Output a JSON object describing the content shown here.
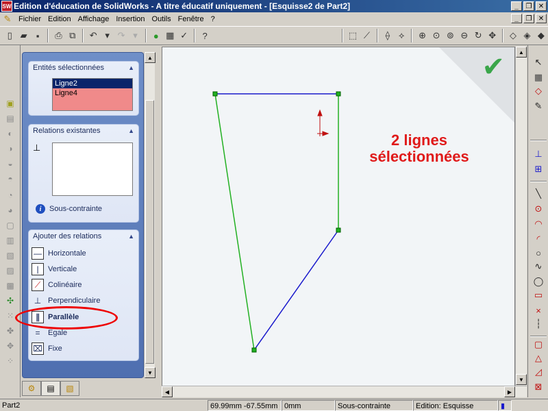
{
  "window": {
    "logo": "SW",
    "title": "Edition d'éducation de SolidWorks - A titre éducatif uniquement - [Esquisse2 de Part2]",
    "minimize": "_",
    "restore": "❐",
    "close": "✕"
  },
  "menu": {
    "items": [
      "Fichier",
      "Edition",
      "Affichage",
      "Insertion",
      "Outils",
      "Fenêtre",
      "?"
    ]
  },
  "panel": {
    "selected": {
      "title": "Entités sélectionnées",
      "items": [
        "Ligne2",
        "Ligne4"
      ]
    },
    "existing": {
      "title": "Relations existantes",
      "status": "Sous-contrainte"
    },
    "add": {
      "title": "Ajouter des relations",
      "buttons": [
        "Horizontale",
        "Verticale",
        "Colinéaire",
        "Perpendiculaire",
        "Parallèle",
        "Egale",
        "Fixe"
      ]
    }
  },
  "canvas": {
    "annotation_line1": "2 lignes",
    "annotation_line2": "sélectionnées",
    "confirm": "✔"
  },
  "status": {
    "part": "Part2",
    "coords": "69.99mm -67.55mm",
    "z": "0mm",
    "state": "Sous-contrainte",
    "mode": "Edition: Esquisse"
  },
  "colors": {
    "selected_line": "#22b022",
    "sketch_line": "#1a1acc",
    "annotation": "#e01a1a",
    "highlight": "#e00000",
    "selection_list": "#f08a8a"
  }
}
